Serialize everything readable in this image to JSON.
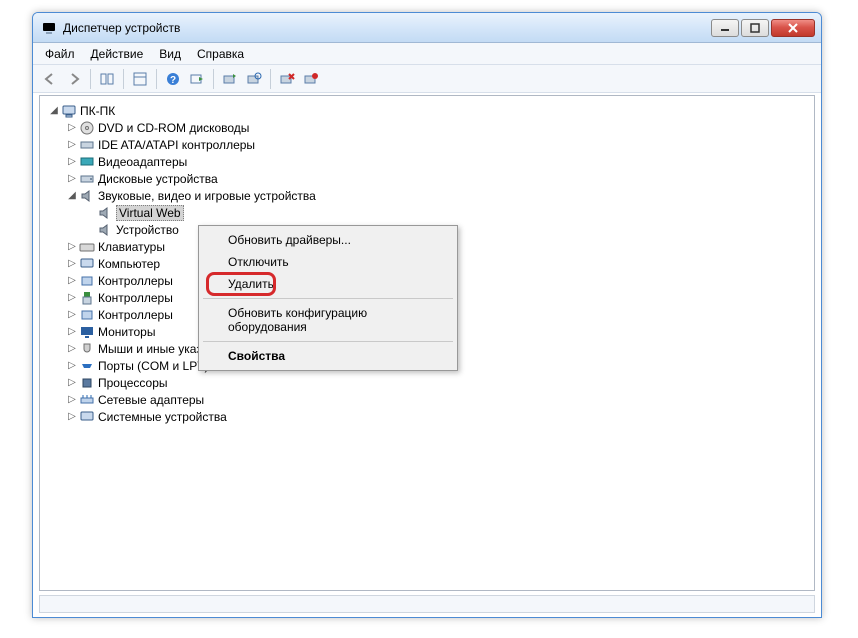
{
  "title": "Диспетчер устройств",
  "menu": {
    "file": "Файл",
    "action": "Действие",
    "view": "Вид",
    "help": "Справка"
  },
  "tree": {
    "root": "ПК-ПК",
    "items": [
      "DVD и CD-ROM дисководы",
      "IDE ATA/ATAPI контроллеры",
      "Видеоадаптеры",
      "Дисковые устройства",
      "Звуковые, видео и игровые устройства",
      "Клавиатуры",
      "Компьютер",
      "Контроллеры",
      "Контроллеры",
      "Контроллеры",
      "Мониторы",
      "Мыши и иные указывающие устройства",
      "Порты (COM и LPT)",
      "Процессоры",
      "Сетевые адаптеры",
      "Системные устройства"
    ],
    "sound_children": {
      "c0": "Virtual Web",
      "c1": "Устройство"
    }
  },
  "context_menu": {
    "update_drivers": "Обновить драйверы...",
    "disable": "Отключить",
    "delete": "Удалить",
    "update_hw": "Обновить конфигурацию оборудования",
    "properties": "Свойства"
  }
}
